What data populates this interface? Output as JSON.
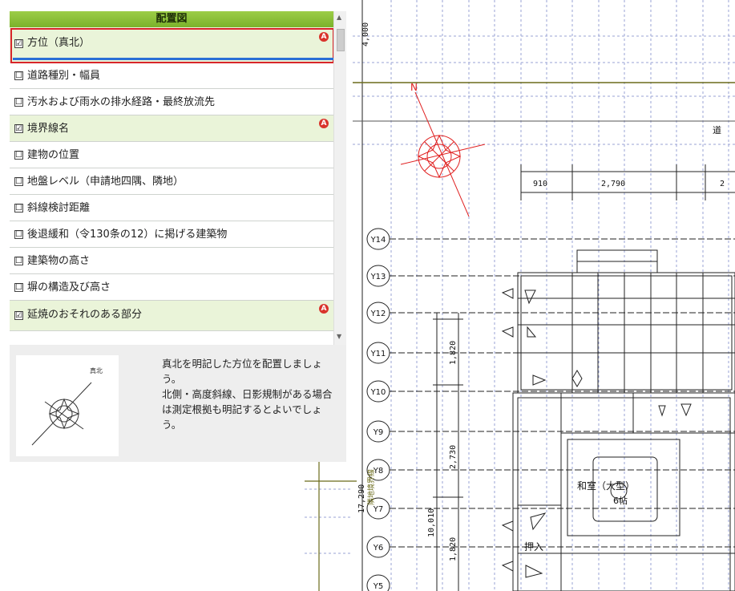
{
  "panel": {
    "title": "配置図",
    "items": [
      {
        "label": "方位（真北）",
        "checked": true,
        "badge": true
      },
      {
        "label": "道路種別・幅員",
        "checked": false,
        "badge": false
      },
      {
        "label": "汚水および雨水の排水経路・最終放流先",
        "checked": false,
        "badge": false
      },
      {
        "label": "境界線名",
        "checked": true,
        "badge": true
      },
      {
        "label": "建物の位置",
        "checked": false,
        "badge": false
      },
      {
        "label": "地盤レベル（申請地四隅、隣地）",
        "checked": false,
        "badge": false
      },
      {
        "label": "斜線検討距離",
        "checked": false,
        "badge": false
      },
      {
        "label": "後退緩和（令130条の12）に掲げる建築物",
        "checked": false,
        "badge": false
      },
      {
        "label": "建築物の高さ",
        "checked": false,
        "badge": false
      },
      {
        "label": "塀の構造及び高さ",
        "checked": false,
        "badge": false
      },
      {
        "label": "延焼のおそれのある部分",
        "checked": true,
        "badge": true
      }
    ],
    "checked_mark": "☑",
    "unchecked_mark": "☐",
    "badge_text": "A",
    "description": {
      "thumb_label": "真北",
      "text": "真北を明記した方位を配置しましょう。\n北側・高度斜線、日影規制がある場合は測定根拠も明記するとよいでしょう。"
    }
  },
  "drawing": {
    "north_label": "N",
    "top_dimension": "4,000",
    "dimensions": [
      "910",
      "2,790",
      "2",
      "1,820",
      "2,730",
      "10,010",
      "1,820"
    ],
    "side_dimension": "17,290",
    "side_label": "隣地境界線",
    "grid_labels": [
      "Y14",
      "Y13",
      "Y12",
      "Y11",
      "Y10",
      "Y9",
      "Y8",
      "Y7",
      "Y6",
      "Y5"
    ],
    "room_label": "和室（大型）",
    "room_sub": "6帖",
    "closet_label": "押入",
    "road_char": "道"
  },
  "colors": {
    "header_green": "#8bc34a",
    "selection_red": "#d8252a",
    "selection_blue": "#2a6fd6",
    "compass_red": "#e02020",
    "boundary_olive": "#6b6b1a"
  }
}
